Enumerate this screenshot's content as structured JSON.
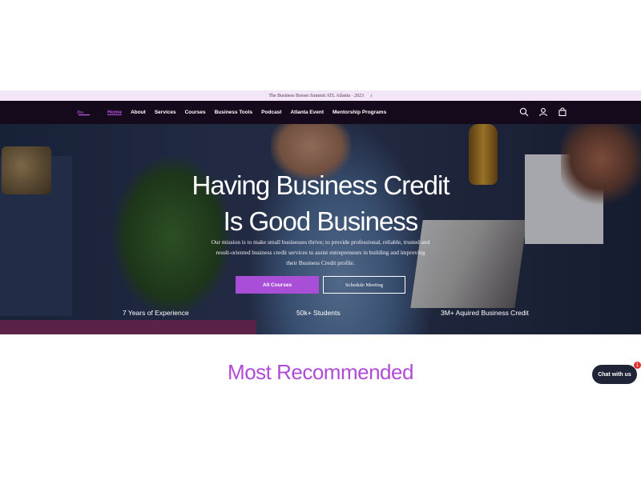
{
  "announcement": {
    "text": "The Business Bosses Summit ATL Atlanta · 2023",
    "chevron": "›"
  },
  "header": {
    "logo_icon": "brand-logo-icon",
    "nav": [
      {
        "label": "Home",
        "active": true
      },
      {
        "label": "About"
      },
      {
        "label": "Services"
      },
      {
        "label": "Courses"
      },
      {
        "label": "Business Tools"
      },
      {
        "label": "Podcast"
      },
      {
        "label": "Atlanta Event"
      },
      {
        "label": "Mentorship Programs"
      }
    ],
    "icons": [
      "search-icon",
      "account-icon",
      "cart-icon"
    ]
  },
  "hero": {
    "title_line1": "Having Business Credit",
    "title_line2": "Is Good Business",
    "subtitle": "Our mission is to make small businesses thrive; to provide professional, reliable, trusted and result-oriented business credit services to assist entrepreneurs in building and improving their Business Credit profile.",
    "primary_button": "All Courses",
    "secondary_button": "Schedule Meeting",
    "stats": [
      "7 Years of Experience",
      "50k+ Students",
      "3M+ Aquired Business Credit"
    ]
  },
  "section": {
    "title": "Most Recommended"
  },
  "chat": {
    "label": "Chat with us",
    "badge": "1"
  },
  "colors": {
    "accent": "#a94ed7",
    "nav_bg": "#150a1c",
    "announce_bg": "#f3e6f7",
    "title": "#b04bd8"
  }
}
